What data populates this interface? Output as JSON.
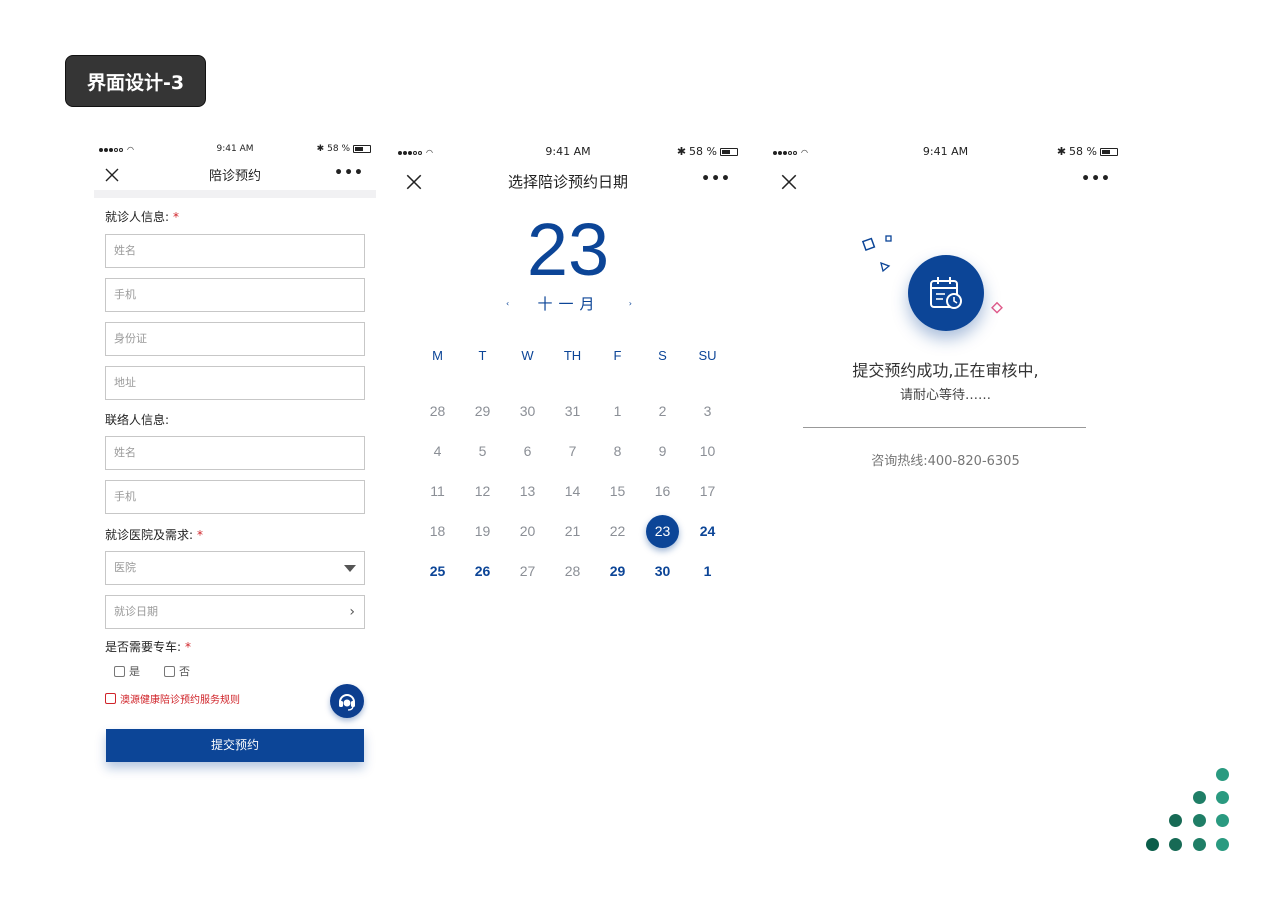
{
  "badge": "界面设计-3",
  "status": {
    "time": "9:41 AM",
    "battery": "58 %"
  },
  "screen1": {
    "title": "陪诊预约",
    "more": "•••",
    "patient_label": "就诊人信息:",
    "patient_fields": [
      "姓名",
      "手机",
      "身份证",
      "地址"
    ],
    "contact_label": "联络人信息:",
    "contact_fields": [
      "姓名",
      "手机"
    ],
    "hospital_label": "就诊医院及需求:",
    "hospital_placeholder": "医院",
    "date_placeholder": "就诊日期",
    "car_label": "是否需要专车:",
    "car_yes": "是",
    "car_no": "否",
    "rules": "澳源健康陪诊预约服务规则",
    "submit": "提交预约",
    "required_mark": "*"
  },
  "screen2": {
    "title": "选择陪诊预约日期",
    "more": "•••",
    "big_day": "23",
    "month": "十一月",
    "prev": "‹",
    "next": "›",
    "weekdays": [
      "M",
      "T",
      "W",
      "TH",
      "F",
      "S",
      "SU"
    ],
    "weeks": [
      [
        "28",
        "29",
        "30",
        "31",
        "1",
        "2",
        "3"
      ],
      [
        "4",
        "5",
        "6",
        "7",
        "8",
        "9",
        "10"
      ],
      [
        "11",
        "12",
        "13",
        "14",
        "15",
        "16",
        "17"
      ],
      [
        "18",
        "19",
        "20",
        "21",
        "22",
        "23",
        "24"
      ],
      [
        "25",
        "26",
        "27",
        "28",
        "29",
        "30",
        "1"
      ]
    ],
    "selected": "23",
    "highlighted": [
      "24",
      "25",
      "26",
      "29",
      "30",
      "1"
    ]
  },
  "screen3": {
    "more": "•••",
    "message_main": "提交预约成功,正在审核中,",
    "message_sub": "请耐心等待……",
    "hotline": "咨询热线:400-820-6305"
  },
  "colors": {
    "primary": "#0c4597",
    "required": "#d0242a",
    "dots_dark": "#0b5e4a",
    "dots_light": "#2a9a80"
  }
}
